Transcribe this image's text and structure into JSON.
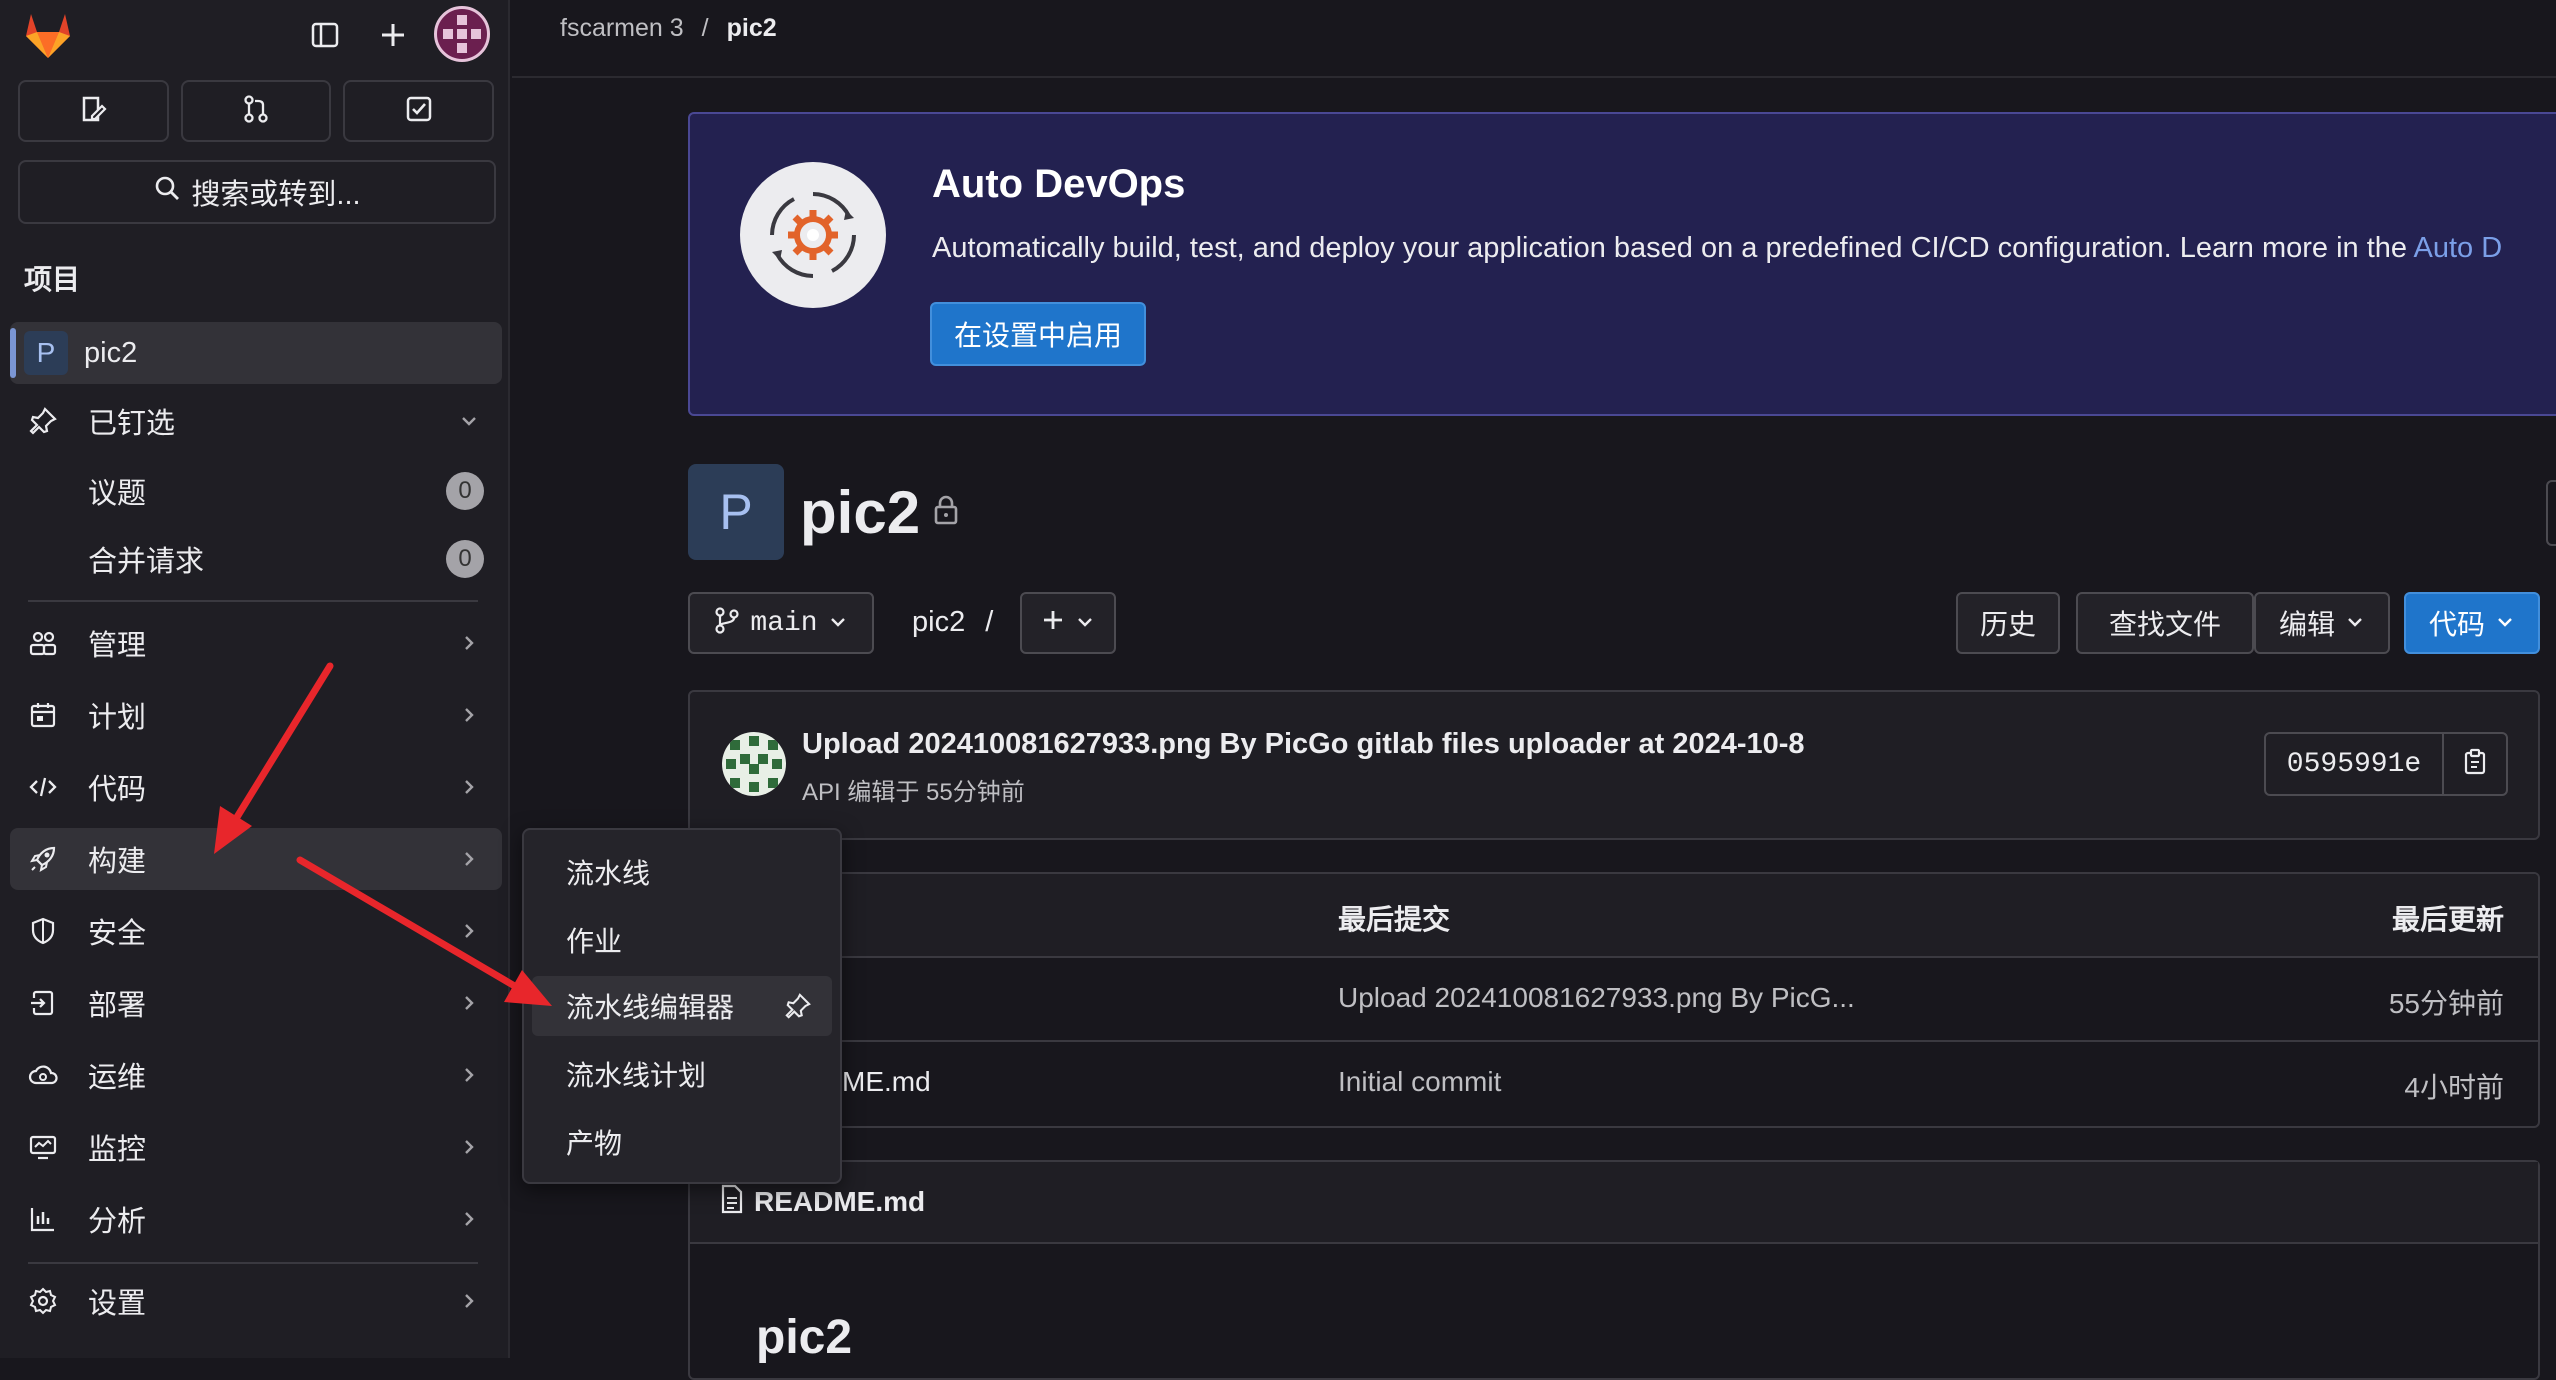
{
  "colors": {
    "accent": "#1f75cb",
    "banner_bg": "#232150",
    "arrow": "#e8262b"
  },
  "topbar": {
    "logo_icon": "gitlab-tanuki-icon",
    "sidebar_toggle_icon": "sidebar-toggle-icon",
    "new_icon": "plus-icon",
    "avatar_icon": "user-avatar"
  },
  "quick_actions": [
    "issues-icon",
    "merge-requests-icon",
    "todos-icon"
  ],
  "search": {
    "label": "搜索或转到..."
  },
  "sidebar": {
    "section_title": "项目",
    "project": {
      "initial": "P",
      "name": "pic2"
    },
    "pinned": {
      "label": "已钉选",
      "items": [
        {
          "label": "议题",
          "count": "0"
        },
        {
          "label": "合并请求",
          "count": "0"
        }
      ]
    },
    "nav": [
      {
        "label": "管理",
        "icon": "users-icon"
      },
      {
        "label": "计划",
        "icon": "calendar-icon"
      },
      {
        "label": "代码",
        "icon": "code-icon"
      },
      {
        "label": "构建",
        "icon": "rocket-icon"
      },
      {
        "label": "安全",
        "icon": "shield-icon"
      },
      {
        "label": "部署",
        "icon": "deploy-icon"
      },
      {
        "label": "运维",
        "icon": "cloud-icon"
      },
      {
        "label": "监控",
        "icon": "monitor-icon"
      },
      {
        "label": "分析",
        "icon": "chart-icon"
      },
      {
        "label": "设置",
        "icon": "gear-icon"
      }
    ]
  },
  "flyout": {
    "items": [
      "流水线",
      "作业",
      "流水线编辑器",
      "流水线计划",
      "产物"
    ]
  },
  "breadcrumb": {
    "parent": "fscarmen 3",
    "separator": "/",
    "current": "pic2"
  },
  "devops": {
    "title": "Auto DevOps",
    "text": "Automatically build, test, and deploy your application based on a predefined CI/CD configuration. Learn more in the ",
    "link": "Auto D",
    "button": "在设置中启用"
  },
  "project_header": {
    "initial": "P",
    "title": "pic2"
  },
  "repo_toolbar": {
    "branch": "main",
    "path": "pic2",
    "path_sep": "/",
    "history": "历史",
    "find_file": "查找文件",
    "edit": "编辑",
    "code": "代码"
  },
  "commit": {
    "title": "Upload 202410081627933.png By PicGo gitlab files uploader at 2024-10-8",
    "meta": "API 编辑于 55分钟前",
    "sha": "0595991e"
  },
  "file_table": {
    "headers": [
      "最后提交",
      "最后更新"
    ],
    "rows": [
      {
        "name": "",
        "commit": "Upload 202410081627933.png By PicG...",
        "updated": "55分钟前"
      },
      {
        "name": "ME.md",
        "commit": "Initial commit",
        "updated": "4小时前"
      }
    ]
  },
  "readme": {
    "filename": "README.md",
    "heading": "pic2"
  }
}
